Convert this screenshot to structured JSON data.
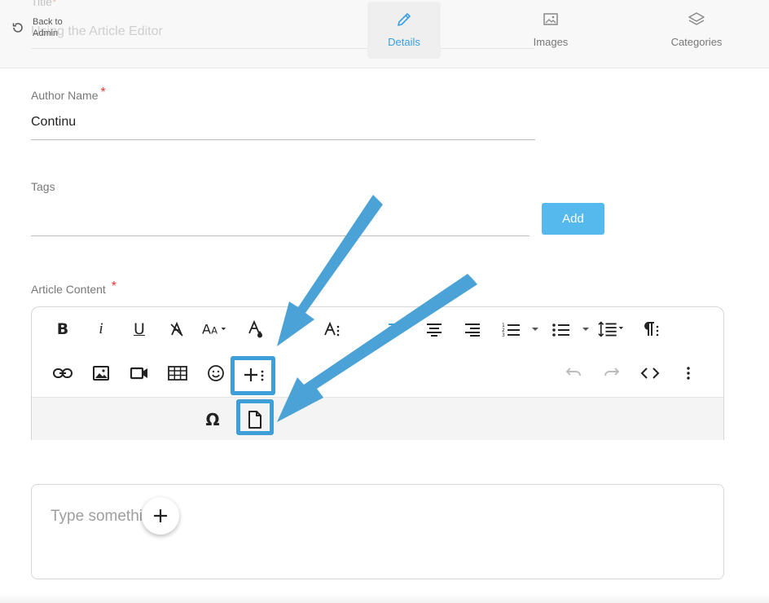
{
  "header": {
    "ghost_title_label": "Title",
    "ghost_title_value": "Using the Article Editor",
    "back_label": "Back to Admin",
    "tabs": [
      {
        "label": "Details",
        "icon": "pencil-icon",
        "active": true
      },
      {
        "label": "Images",
        "icon": "image-icon",
        "active": false
      },
      {
        "label": "Categories",
        "icon": "layers-icon",
        "active": false
      }
    ]
  },
  "form": {
    "author": {
      "label": "Author Name",
      "required_mark": "*",
      "value": "Continu"
    },
    "tags": {
      "label": "Tags",
      "value": "",
      "add_label": "Add"
    },
    "content": {
      "label": "Article Content",
      "required_mark": "*",
      "placeholder": "Type something"
    }
  },
  "toolbar": {
    "row1": [
      "bold-icon",
      "italic-icon",
      "underline-icon",
      "clear-format-icon",
      "font-size-icon",
      "text-color-icon",
      "text-style-icon",
      "align-left-icon",
      "align-center-icon",
      "align-right-icon",
      "ordered-list-icon",
      "unordered-list-icon",
      "line-height-icon",
      "paragraph-format-icon"
    ],
    "row2": [
      "link-icon",
      "insert-image-icon",
      "insert-video-icon",
      "insert-table-icon",
      "emoticon-icon",
      "more-insert-icon",
      "undo-icon",
      "redo-icon",
      "code-view-icon",
      "more-menu-icon"
    ],
    "row3": [
      "special-characters-icon",
      "insert-file-icon"
    ],
    "special_char_glyph": "Ω",
    "bold_glyph": "B",
    "italic_glyph": "i",
    "underline_glyph": "U"
  },
  "colors": {
    "accent": "#3a9fde",
    "add_button": "#56b9ee",
    "annotation": "#3d9ed8",
    "required": "#e53935"
  }
}
